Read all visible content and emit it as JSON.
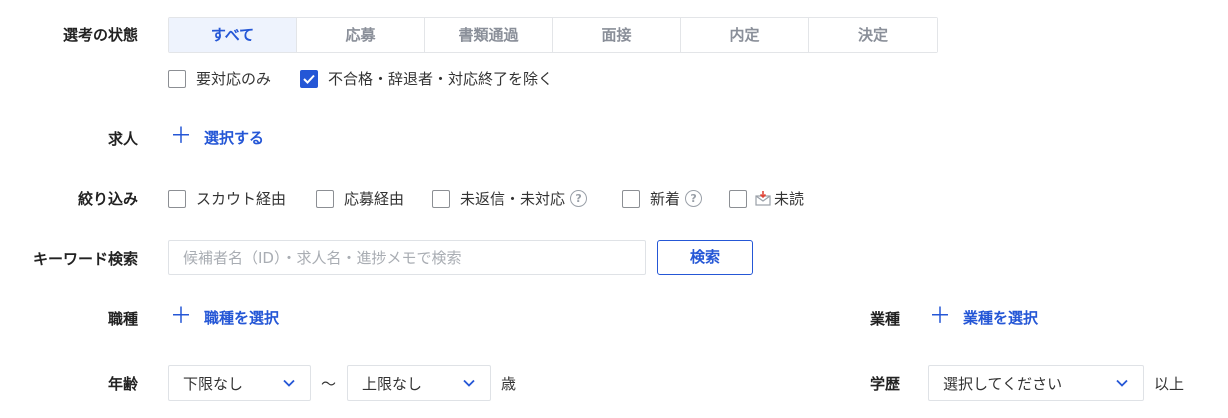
{
  "status": {
    "label": "選考の状態",
    "tabs": [
      {
        "label": "すべて",
        "active": true
      },
      {
        "label": "応募",
        "active": false
      },
      {
        "label": "書類通過",
        "active": false
      },
      {
        "label": "面接",
        "active": false
      },
      {
        "label": "内定",
        "active": false
      },
      {
        "label": "決定",
        "active": false
      }
    ],
    "checkbox_action_required": {
      "label": "要対応のみ",
      "checked": false
    },
    "checkbox_exclude": {
      "label": "不合格・辞退者・対応終了を除く",
      "checked": true
    }
  },
  "job": {
    "label": "求人",
    "link": "選択する"
  },
  "filter": {
    "label": "絞り込み",
    "options": [
      {
        "label": "スカウト経由",
        "checked": false
      },
      {
        "label": "応募経由",
        "checked": false
      },
      {
        "label": "未返信・未対応",
        "checked": false,
        "help": "?"
      },
      {
        "label": "新着",
        "checked": false,
        "help": "?"
      },
      {
        "label": "未読",
        "checked": false,
        "icon": "unread-mail-icon"
      }
    ]
  },
  "keyword": {
    "label": "キーワード検索",
    "placeholder": "候補者名（ID）・求人名・進捗メモで検索",
    "value": "",
    "button": "検索"
  },
  "occupation": {
    "label": "職種",
    "link": "職種を選択"
  },
  "industry": {
    "label": "業種",
    "link": "業種を選択"
  },
  "age": {
    "label": "年齢",
    "min": "下限なし",
    "separator": "〜",
    "max": "上限なし",
    "unit": "歳"
  },
  "education": {
    "label": "学歴",
    "value": "選択してください",
    "suffix": "以上"
  },
  "colors": {
    "accent": "#2557d6",
    "active_tab_bg": "#eef3fd",
    "border": "#e3e5e8",
    "muted": "#8a8f99"
  }
}
